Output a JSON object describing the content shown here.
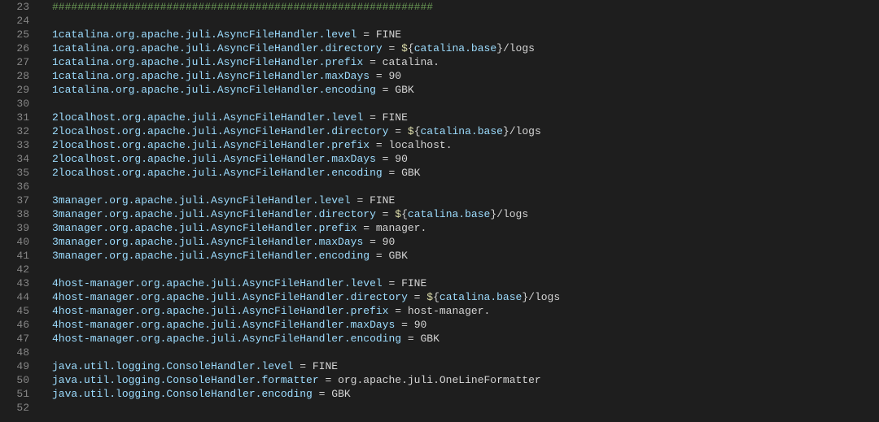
{
  "startLine": 23,
  "lines": [
    {
      "tokens": [
        {
          "t": "############################################################",
          "c": "comment"
        }
      ]
    },
    {
      "tokens": []
    },
    {
      "tokens": [
        {
          "t": "1catalina.org.apache.juli.AsyncFileHandler.level",
          "c": "key"
        },
        {
          "t": " = ",
          "c": "default"
        },
        {
          "t": "FINE",
          "c": "default"
        }
      ]
    },
    {
      "tokens": [
        {
          "t": "1catalina.org.apache.juli.AsyncFileHandler.directory",
          "c": "key"
        },
        {
          "t": " = ",
          "c": "default"
        },
        {
          "t": "$",
          "c": "special"
        },
        {
          "t": "{",
          "c": "punct"
        },
        {
          "t": "catalina.base",
          "c": "key"
        },
        {
          "t": "}",
          "c": "punct"
        },
        {
          "t": "/logs",
          "c": "default"
        }
      ]
    },
    {
      "tokens": [
        {
          "t": "1catalina.org.apache.juli.AsyncFileHandler.prefix",
          "c": "key"
        },
        {
          "t": " = ",
          "c": "default"
        },
        {
          "t": "catalina.",
          "c": "default"
        }
      ]
    },
    {
      "tokens": [
        {
          "t": "1catalina.org.apache.juli.AsyncFileHandler.maxDays",
          "c": "key"
        },
        {
          "t": " = ",
          "c": "default"
        },
        {
          "t": "90",
          "c": "default"
        }
      ]
    },
    {
      "tokens": [
        {
          "t": "1catalina.org.apache.juli.AsyncFileHandler.encoding",
          "c": "key"
        },
        {
          "t": " = ",
          "c": "default"
        },
        {
          "t": "GBK",
          "c": "default"
        }
      ]
    },
    {
      "tokens": []
    },
    {
      "tokens": [
        {
          "t": "2localhost.org.apache.juli.AsyncFileHandler.level",
          "c": "key"
        },
        {
          "t": " = ",
          "c": "default"
        },
        {
          "t": "FINE",
          "c": "default"
        }
      ]
    },
    {
      "tokens": [
        {
          "t": "2localhost.org.apache.juli.AsyncFileHandler.directory",
          "c": "key"
        },
        {
          "t": " = ",
          "c": "default"
        },
        {
          "t": "$",
          "c": "special"
        },
        {
          "t": "{",
          "c": "punct"
        },
        {
          "t": "catalina.base",
          "c": "key"
        },
        {
          "t": "}",
          "c": "punct"
        },
        {
          "t": "/logs",
          "c": "default"
        }
      ]
    },
    {
      "tokens": [
        {
          "t": "2localhost.org.apache.juli.AsyncFileHandler.prefix",
          "c": "key"
        },
        {
          "t": " = ",
          "c": "default"
        },
        {
          "t": "localhost.",
          "c": "default"
        }
      ]
    },
    {
      "tokens": [
        {
          "t": "2localhost.org.apache.juli.AsyncFileHandler.maxDays",
          "c": "key"
        },
        {
          "t": " = ",
          "c": "default"
        },
        {
          "t": "90",
          "c": "default"
        }
      ]
    },
    {
      "tokens": [
        {
          "t": "2localhost.org.apache.juli.AsyncFileHandler.encoding",
          "c": "key"
        },
        {
          "t": " = ",
          "c": "default"
        },
        {
          "t": "GBK",
          "c": "default"
        }
      ]
    },
    {
      "tokens": []
    },
    {
      "tokens": [
        {
          "t": "3manager.org.apache.juli.AsyncFileHandler.level",
          "c": "key"
        },
        {
          "t": " = ",
          "c": "default"
        },
        {
          "t": "FINE",
          "c": "default"
        }
      ]
    },
    {
      "tokens": [
        {
          "t": "3manager.org.apache.juli.AsyncFileHandler.directory",
          "c": "key"
        },
        {
          "t": " = ",
          "c": "default"
        },
        {
          "t": "$",
          "c": "special"
        },
        {
          "t": "{",
          "c": "punct"
        },
        {
          "t": "catalina.base",
          "c": "key"
        },
        {
          "t": "}",
          "c": "punct"
        },
        {
          "t": "/logs",
          "c": "default"
        }
      ]
    },
    {
      "tokens": [
        {
          "t": "3manager.org.apache.juli.AsyncFileHandler.prefix",
          "c": "key"
        },
        {
          "t": " = ",
          "c": "default"
        },
        {
          "t": "manager.",
          "c": "default"
        }
      ]
    },
    {
      "tokens": [
        {
          "t": "3manager.org.apache.juli.AsyncFileHandler.maxDays",
          "c": "key"
        },
        {
          "t": " = ",
          "c": "default"
        },
        {
          "t": "90",
          "c": "default"
        }
      ]
    },
    {
      "tokens": [
        {
          "t": "3manager.org.apache.juli.AsyncFileHandler.encoding",
          "c": "key"
        },
        {
          "t": " = ",
          "c": "default"
        },
        {
          "t": "GBK",
          "c": "default"
        }
      ]
    },
    {
      "tokens": []
    },
    {
      "tokens": [
        {
          "t": "4host-manager.org.apache.juli.AsyncFileHandler.level",
          "c": "key"
        },
        {
          "t": " = ",
          "c": "default"
        },
        {
          "t": "FINE",
          "c": "default"
        }
      ]
    },
    {
      "tokens": [
        {
          "t": "4host-manager.org.apache.juli.AsyncFileHandler.directory",
          "c": "key"
        },
        {
          "t": " = ",
          "c": "default"
        },
        {
          "t": "$",
          "c": "special"
        },
        {
          "t": "{",
          "c": "punct"
        },
        {
          "t": "catalina.base",
          "c": "key"
        },
        {
          "t": "}",
          "c": "punct"
        },
        {
          "t": "/logs",
          "c": "default"
        }
      ]
    },
    {
      "tokens": [
        {
          "t": "4host-manager.org.apache.juli.AsyncFileHandler.prefix",
          "c": "key"
        },
        {
          "t": " = ",
          "c": "default"
        },
        {
          "t": "host-manager.",
          "c": "default"
        }
      ]
    },
    {
      "tokens": [
        {
          "t": "4host-manager.org.apache.juli.AsyncFileHandler.maxDays",
          "c": "key"
        },
        {
          "t": " = ",
          "c": "default"
        },
        {
          "t": "90",
          "c": "default"
        }
      ]
    },
    {
      "tokens": [
        {
          "t": "4host-manager.org.apache.juli.AsyncFileHandler.encoding",
          "c": "key"
        },
        {
          "t": " = ",
          "c": "default"
        },
        {
          "t": "GBK",
          "c": "default"
        }
      ]
    },
    {
      "tokens": []
    },
    {
      "tokens": [
        {
          "t": "java.util.logging.ConsoleHandler.level",
          "c": "key"
        },
        {
          "t": " = ",
          "c": "default"
        },
        {
          "t": "FINE",
          "c": "default"
        }
      ]
    },
    {
      "tokens": [
        {
          "t": "java.util.logging.ConsoleHandler.formatter",
          "c": "key"
        },
        {
          "t": " = ",
          "c": "default"
        },
        {
          "t": "org.apache.juli.OneLineFormatter",
          "c": "default"
        }
      ]
    },
    {
      "tokens": [
        {
          "t": "java.util.logging.ConsoleHandler.encoding",
          "c": "key"
        },
        {
          "t": " = ",
          "c": "default"
        },
        {
          "t": "GBK",
          "c": "default"
        }
      ]
    },
    {
      "tokens": []
    }
  ]
}
